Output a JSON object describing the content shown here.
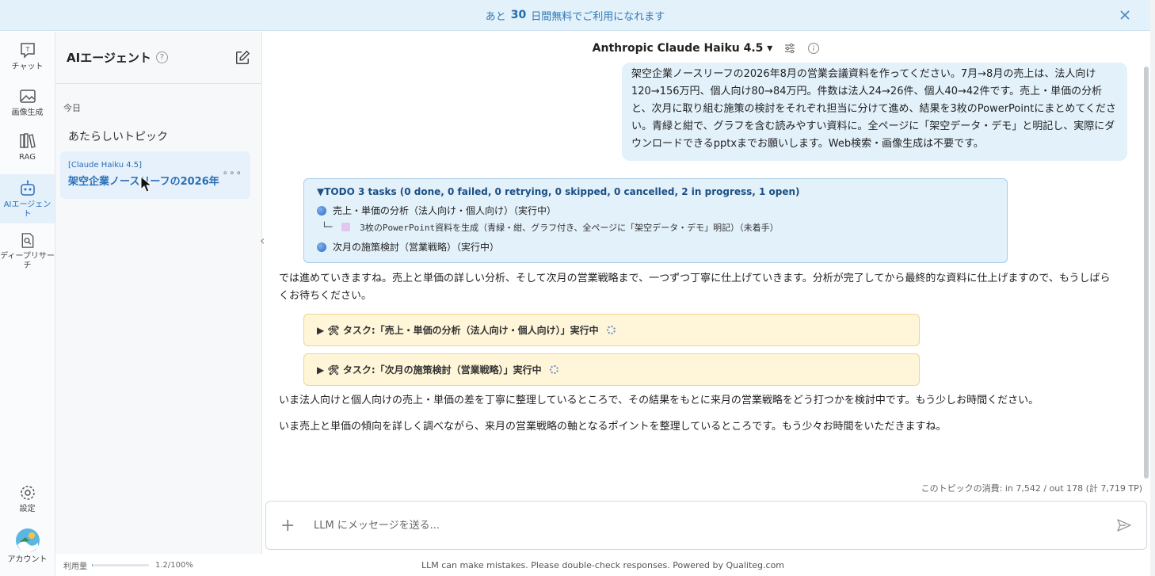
{
  "banner": {
    "prefix": "あと",
    "days": "30",
    "suffix": "日間無料でご利用になれます"
  },
  "rail": {
    "items": [
      {
        "label": "チャット",
        "icon": "chat-icon"
      },
      {
        "label": "画像生成",
        "icon": "image-icon"
      },
      {
        "label": "RAG",
        "icon": "books-icon"
      },
      {
        "label": "AIエージェント",
        "icon": "robot-icon"
      },
      {
        "label": "ディープリサーチ",
        "icon": "research-icon"
      }
    ],
    "settings": "設定",
    "account": "アカウント"
  },
  "topics": {
    "title": "AIエージェント",
    "help": "?",
    "section": "今日",
    "new_topic": "あたらしいトピック",
    "active": {
      "model": "[Claude Haiku 4.5]",
      "name": "架空企業ノースリーフの2026年",
      "more": "∘∘∘"
    }
  },
  "header": {
    "model": "Anthropic Claude Haiku 4.5 ▾"
  },
  "user_message": "架空企業ノースリーフの2026年8月の営業会議資料を作ってください。7月→8月の売上は、法人向け120→156万円、個人向け80→84万円。件数は法人24→26件、個人40→42件です。売上・単価の分析と、次月に取り組む施策の検討をそれぞれ担当に分けて進め、結果を3枚のPowerPointにまとめてください。青緑と紺で、グラフを含む読みやすい資料に。全ページに「架空データ・デモ」と明記し、実際にダウンロードできるpptxまでお願いします。Web検索・画像生成は不要です。",
  "todo": {
    "title": "▼TODO 3 tasks (0 done, 0 failed, 0 retrying, 0 skipped, 0 cancelled, 2 in progress, 1 open)",
    "items": [
      "売上・単価の分析（法人向け・個人向け）（実行中）",
      "└─",
      "3枚のPowerPoint資料を生成（青緑・紺、グラフ付き、全ページに「架空データ・デモ」明記）（未着手）",
      "次月の施策検討（営業戦略）（実行中）"
    ]
  },
  "assistant": {
    "msg1": "では進めていきますね。売上と単価の詳しい分析、そして次月の営業戦略まで、一つずつ丁寧に仕上げていきます。分析が完了してから最終的な資料に仕上げますので、もうしばらくお待ちください。",
    "task1": "▶ 🛠 タスク:「売上・単価の分析（法人向け・個人向け）」実行中",
    "task2": "▶ 🛠 タスク:「次月の施策検討（営業戦略）」実行中",
    "msg2": "いま法人向けと個人向けの売上・単価の差を丁寧に整理しているところで、その結果をもとに来月の営業戦略をどう打つかを検討中です。もう少しお時間ください。",
    "msg3": "いま売上と単価の傾向を詳しく調べながら、来月の営業戦略の軸となるポイントを整理しているところです。もう少々お時間をいただきますね。"
  },
  "usage_line": "このトピックの消費: in 7,542 / out 178 (計 7,719 TP)",
  "composer": {
    "plus": "+",
    "placeholder": "LLM にメッセージを送る..."
  },
  "footer": {
    "usage_label": "利用量",
    "usage_value": "1.2/100%",
    "usage_fraction": 0.012,
    "disclaimer": "LLM can make mistakes. Please double-check responses. Powered by Qualiteg.com"
  }
}
